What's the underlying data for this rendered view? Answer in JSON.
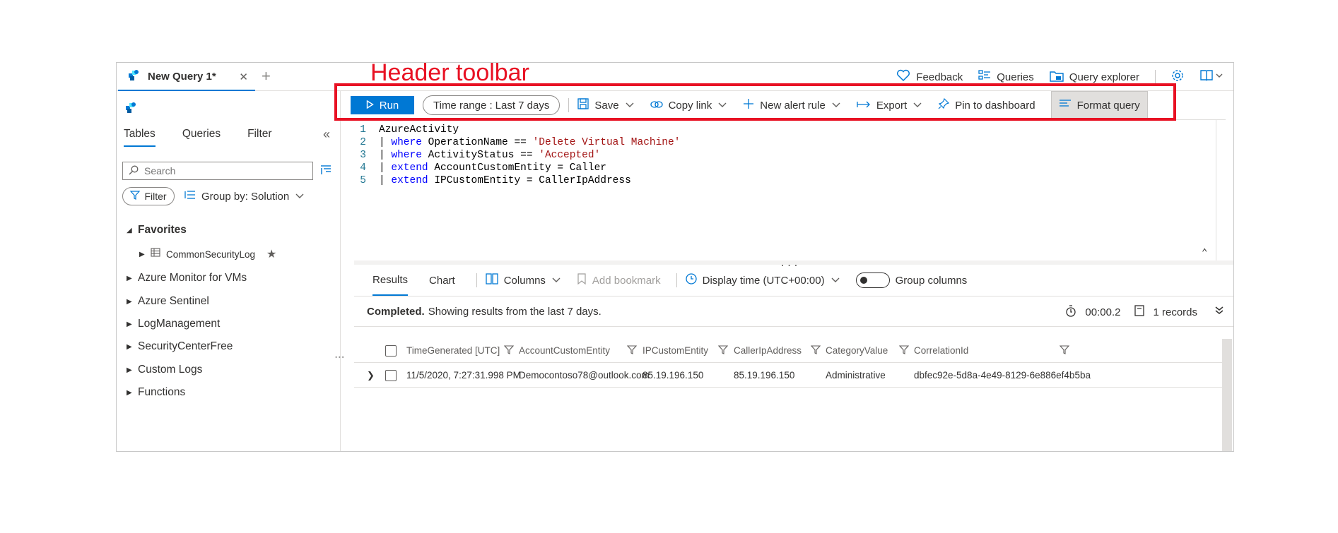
{
  "annotation": {
    "label": "Header toolbar"
  },
  "tabbar": {
    "tab_title": "New Query 1*",
    "close": "✕",
    "add": "+",
    "feedback": "Feedback",
    "queries": "Queries",
    "query_explorer": "Query explorer"
  },
  "left_pane": {
    "tabs": [
      "Tables",
      "Queries",
      "Filter"
    ],
    "collapse": "«",
    "search_placeholder": "Search",
    "filter_label": "Filter",
    "group_by_label": "Group by: Solution",
    "favorites_label": "Favorites",
    "favorite_item": "CommonSecurityLog",
    "groups": [
      "Azure Monitor for VMs",
      "Azure Sentinel",
      "LogManagement",
      "SecurityCenterFree",
      "Custom Logs",
      "Functions"
    ]
  },
  "toolbar": {
    "run": "Run",
    "time_range_label": "Time range :",
    "time_range_value": "Last 7 days",
    "save": "Save",
    "copy_link": "Copy link",
    "new_alert_rule": "New alert rule",
    "export": "Export",
    "pin_to_dashboard": "Pin to dashboard",
    "format_query": "Format query"
  },
  "editor": {
    "line_numbers": [
      "1",
      "2",
      "3",
      "4",
      "5"
    ],
    "lines": [
      {
        "kw": "",
        "text": "AzureActivity",
        "str": ""
      },
      {
        "kw": "where",
        "text": " OperationName == ",
        "str": "'Delete Virtual Machine'"
      },
      {
        "kw": "where",
        "text": " ActivityStatus == ",
        "str": "'Accepted'"
      },
      {
        "kw": "extend",
        "text": " AccountCustomEntity = Caller",
        "str": ""
      },
      {
        "kw": "extend",
        "text": " IPCustomEntity = CallerIpAddress",
        "str": ""
      }
    ],
    "dots": "...",
    "collapse": "⌃"
  },
  "results": {
    "tabs": [
      "Results",
      "Chart"
    ],
    "columns": "Columns",
    "add_bookmark": "Add bookmark",
    "display_time": "Display time (UTC+00:00)",
    "group_columns": "Group columns",
    "status_bold": "Completed.",
    "status_text": "Showing results from the last 7 days.",
    "duration": "00:00.2",
    "records": "1 records",
    "headers": [
      "TimeGenerated [UTC]",
      "AccountCustomEntity",
      "IPCustomEntity",
      "CallerIpAddress",
      "CategoryValue",
      "CorrelationId"
    ],
    "rows": [
      [
        "11/5/2020, 7:27:31.998 PM",
        "Democontoso78@outlook.com",
        "85.19.196.150",
        "85.19.196.150",
        "Administrative",
        "dbfec92e-5d8a-4e49-8129-6e886ef4b5ba"
      ]
    ]
  },
  "colors": {
    "accent": "#0078d4",
    "annotation": "#e81123",
    "keyword": "#0000ff",
    "string": "#a31515"
  }
}
